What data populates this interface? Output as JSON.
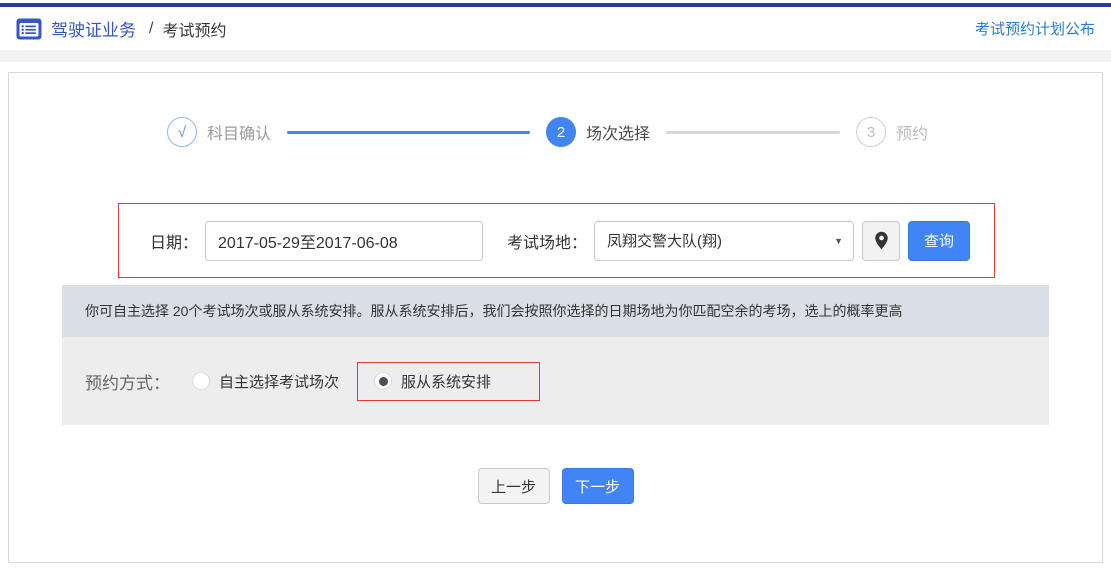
{
  "colors": {
    "top_border": "#2a3b8f",
    "accent_blue": "#4184f3",
    "breadcrumb_blue": "#3556c4",
    "link_blue": "#2d7bd2",
    "highlight_red": "#e03a35",
    "notice_bar_bg": "#dadee5",
    "booking_bar_bg": "#ededee"
  },
  "header": {
    "icon": "list-icon",
    "title_primary": "驾驶证业务",
    "separator": "/",
    "title_secondary": "考试预约",
    "link": "考试预约计划公布"
  },
  "stepper": {
    "steps": [
      {
        "marker": "√",
        "label": "科目确认",
        "state": "done"
      },
      {
        "marker": "2",
        "label": "场次选择",
        "state": "active"
      },
      {
        "marker": "3",
        "label": "预约",
        "state": "pending"
      }
    ]
  },
  "filter": {
    "date_label": "日期：",
    "date_value": "2017-05-29至2017-06-08",
    "venue_label": "考试场地：",
    "venue_value": "凤翔交警大队(翔)",
    "caret": "▼",
    "pin_icon": "location-pin-icon",
    "search_label": "查询"
  },
  "notice": "你可自主选择 20个考试场次或服从系统安排。服从系统安排后，我们会按照你选择的日期场地为你匹配空余的考场，选上的概率更高",
  "booking": {
    "label": "预约方式：",
    "options": [
      {
        "label": "自主选择考试场次",
        "selected": false
      },
      {
        "label": "服从系统安排",
        "selected": true
      }
    ]
  },
  "footer": {
    "prev": "上一步",
    "next": "下一步"
  }
}
